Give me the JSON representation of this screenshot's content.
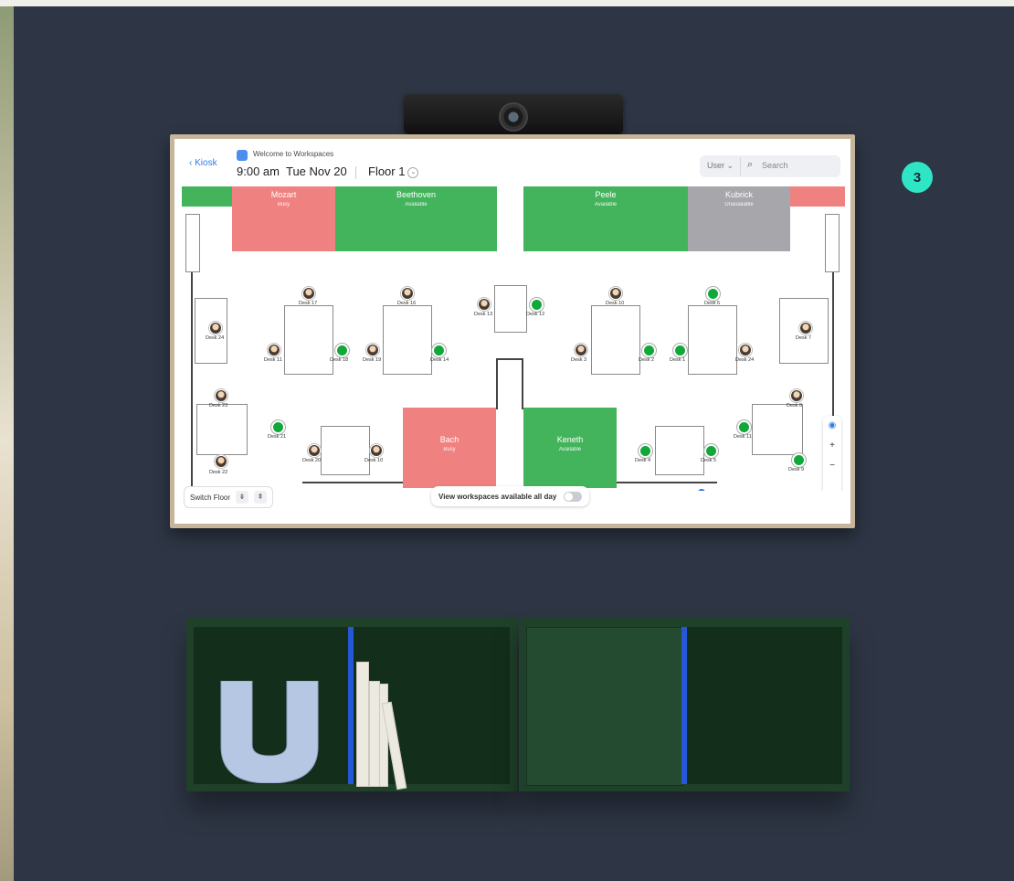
{
  "header": {
    "back_label": "Kiosk",
    "app_title": "Welcome to Workspaces",
    "time": "9:00 am",
    "date": "Tue Nov 20",
    "floor": "Floor 1",
    "search_filter": "User",
    "search_placeholder": "Search"
  },
  "badge": "3",
  "rooms": [
    {
      "name": "Mozart",
      "status": "Busy",
      "color": "#ef8280"
    },
    {
      "name": "Beethoven",
      "status": "Available",
      "color": "#44b45c"
    },
    {
      "name": "Peele",
      "status": "Available",
      "color": "#44b45c"
    },
    {
      "name": "Kubrick",
      "status": "Unavailable",
      "color": "#a7a7ab"
    },
    {
      "name": "Bach",
      "status": "Busy",
      "color": "#ef8280"
    },
    {
      "name": "Keneth",
      "status": "Available",
      "color": "#44b45c"
    }
  ],
  "desks": {
    "d24a": "Desk 24",
    "d17": "Desk 17",
    "d16": "Desk 16",
    "d11": "Desk 11",
    "d18": "Desk 18",
    "d19": "Desk 19",
    "d14": "Desk 14",
    "d13": "Desk 13",
    "d12": "Desk 12",
    "d10a": "Desk 10",
    "d3": "Desk 3",
    "d2": "Desk 2",
    "d6": "Desk 6",
    "d1": "Desk 1",
    "d24b": "Desk 24",
    "d7": "Desk 7",
    "d23": "Desk 23",
    "d21": "Desk 21",
    "d22": "Desk 22",
    "d20": "Desk 20",
    "d10b": "Desk 10",
    "d4": "Desk 4",
    "d5": "Desk 5",
    "d8": "Desk 8",
    "d11b": "Desk 11",
    "d9": "Desk 9"
  },
  "footer": {
    "switch_floor": "Switch Floor",
    "down_icon": "⇟",
    "up_icon": "⇞",
    "available_all_day": "View workspaces available all day"
  },
  "map_controls": {
    "locate": "◉",
    "zoom_in": "+",
    "zoom_out": "−",
    "settings": "⚙"
  },
  "colors": {
    "busy": "#ef8280",
    "available": "#44b45c",
    "unavailable": "#a7a7ab",
    "desk_free": "#11a83a",
    "accent": "#2f7de6",
    "badge": "#2ee6c5"
  }
}
